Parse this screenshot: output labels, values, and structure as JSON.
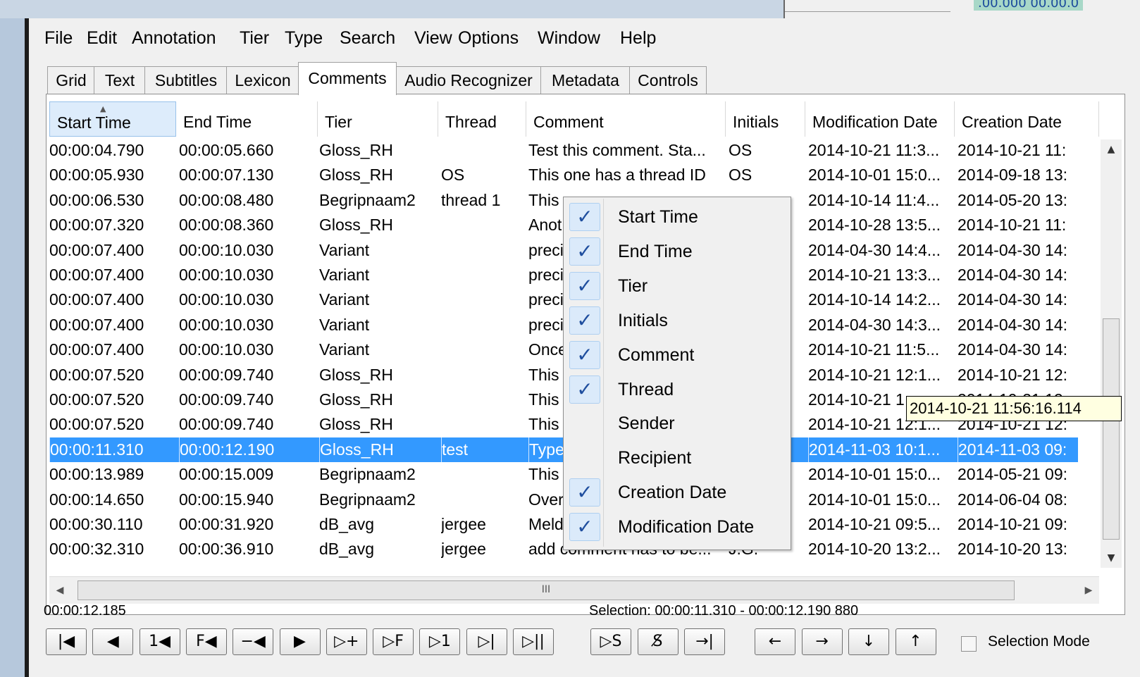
{
  "background": {
    "right_panel_text": ".00.000    00.00.0"
  },
  "menu": [
    "File",
    "Edit",
    "Annotation",
    "Tier",
    "Type",
    "Search",
    "View",
    "Options",
    "Window",
    "Help"
  ],
  "tabs": [
    "Grid",
    "Text",
    "Subtitles",
    "Lexicon",
    "Comments",
    "Audio Recognizer",
    "Metadata",
    "Controls"
  ],
  "active_tab": "Comments",
  "table": {
    "columns": [
      "Start Time",
      "End Time",
      "Tier",
      "Thread",
      "Comment",
      "Initials",
      "Modification Date",
      "Creation Date"
    ],
    "sorted_column": "Start Time",
    "rows": [
      [
        "00:00:04.790",
        "00:00:05.660",
        "Gloss_RH",
        "",
        "Test this comment. Sta...",
        "OS",
        "2014-10-21 11:3...",
        "2014-10-21 11:"
      ],
      [
        "00:00:05.930",
        "00:00:07.130",
        "Gloss_RH",
        "OS",
        "This one has a thread ID",
        "OS",
        "2014-10-01 15:0...",
        "2014-09-18 13:"
      ],
      [
        "00:00:06.530",
        "00:00:08.480",
        "Begripnaam2",
        "thread 1",
        "This",
        "",
        "2014-10-14 11:4...",
        "2014-05-20 13:"
      ],
      [
        "00:00:07.320",
        "00:00:08.360",
        "Gloss_RH",
        "",
        "Anot",
        "",
        "2014-10-28 13:5...",
        "2014-10-21 11:"
      ],
      [
        "00:00:07.400",
        "00:00:10.030",
        "Variant",
        "",
        "preci",
        "",
        "2014-04-30 14:4...",
        "2014-04-30 14:"
      ],
      [
        "00:00:07.400",
        "00:00:10.030",
        "Variant",
        "",
        "preci",
        "",
        "2014-10-21 13:3...",
        "2014-04-30 14:"
      ],
      [
        "00:00:07.400",
        "00:00:10.030",
        "Variant",
        "",
        "preci",
        "",
        "2014-10-14 14:2...",
        "2014-04-30 14:"
      ],
      [
        "00:00:07.400",
        "00:00:10.030",
        "Variant",
        "",
        "preci",
        "",
        "2014-04-30 14:3...",
        "2014-04-30 14:"
      ],
      [
        "00:00:07.400",
        "00:00:10.030",
        "Variant",
        "",
        "Once",
        "",
        "2014-10-21 11:5...",
        "2014-04-30 14:"
      ],
      [
        "00:00:07.520",
        "00:00:09.740",
        "Gloss_RH",
        "",
        "This",
        "",
        "2014-10-21 12:1...",
        "2014-10-21 12:"
      ],
      [
        "00:00:07.520",
        "00:00:09.740",
        "Gloss_RH",
        "",
        "This",
        "",
        "2014-10-21 1",
        "2014-10-21 12:"
      ],
      [
        "00:00:07.520",
        "00:00:09.740",
        "Gloss_RH",
        "",
        "This",
        "",
        "2014-10-21 12:1...",
        "2014-10-21 12:"
      ],
      [
        "00:00:11.310",
        "00:00:12.190",
        "Gloss_RH",
        "test",
        "Type",
        "",
        "2014-11-03 10:1...",
        "2014-11-03 09:"
      ],
      [
        "00:00:13.989",
        "00:00:15.009",
        "Begripnaam2",
        "",
        "This",
        "",
        "2014-10-01 15:0...",
        "2014-05-21 09:"
      ],
      [
        "00:00:14.650",
        "00:00:15.940",
        "Begripnaam2",
        "",
        "Over",
        "",
        "2014-10-01 15:0...",
        "2014-06-04 08:"
      ],
      [
        "00:00:30.110",
        "00:00:31.920",
        "dB_avg",
        "jergee",
        "Meldi",
        "",
        "2014-10-21 09:5...",
        "2014-10-21 09:"
      ],
      [
        "00:00:32.310",
        "00:00:36.910",
        "dB_avg",
        "jergee",
        "add comment has to be...",
        "J.G.",
        "2014-10-20 13:2...",
        "2014-10-20 13:"
      ]
    ],
    "selected_row": 12
  },
  "column_menu": {
    "items": [
      {
        "label": "Start Time",
        "checked": true
      },
      {
        "label": "End Time",
        "checked": true
      },
      {
        "label": "Tier",
        "checked": true
      },
      {
        "label": "Initials",
        "checked": true
      },
      {
        "label": "Comment",
        "checked": true
      },
      {
        "label": "Thread",
        "checked": true
      },
      {
        "label": "Sender",
        "checked": false
      },
      {
        "label": "Recipient",
        "checked": false
      },
      {
        "label": "Creation Date",
        "checked": true
      },
      {
        "label": "Modification Date",
        "checked": true
      }
    ],
    "check_glyph": "✓"
  },
  "tooltip": "2014-10-21 11:56:16.114",
  "scrollbars": {
    "up_glyph": "▲",
    "down_glyph": "▼",
    "left_glyph": "◀",
    "right_glyph": "▶",
    "grip_glyph": "III"
  },
  "status": {
    "current_time": "00:00:12.185",
    "selection": "Selection: 00:00:11.310 - 00:00:12.190  880"
  },
  "transport_buttons": [
    {
      "name": "go-to-begin-button",
      "glyph": "|◀"
    },
    {
      "name": "previous-frame-button",
      "glyph": "◀"
    },
    {
      "name": "back-one-second-button",
      "glyph": "1◀"
    },
    {
      "name": "frame-back-button",
      "glyph": "F◀"
    },
    {
      "name": "previous-boundary-button",
      "glyph": "−◀"
    },
    {
      "name": "play-button",
      "glyph": "▶"
    },
    {
      "name": "play-around-button",
      "glyph": "▷+"
    },
    {
      "name": "frame-forward-button",
      "glyph": "▷F"
    },
    {
      "name": "forward-one-second-button",
      "glyph": "▷1"
    },
    {
      "name": "next-frame-button",
      "glyph": "▷|"
    },
    {
      "name": "go-to-end-button",
      "glyph": "▷||"
    }
  ],
  "selection_buttons": [
    {
      "name": "play-selection-button",
      "glyph": "▷S"
    },
    {
      "name": "clear-selection-button",
      "glyph": "S̸"
    },
    {
      "name": "go-to-selection-end-button",
      "glyph": "→|"
    }
  ],
  "navigation_buttons": [
    {
      "name": "arrow-left-button",
      "glyph": "←"
    },
    {
      "name": "arrow-right-button",
      "glyph": "→"
    },
    {
      "name": "arrow-down-button",
      "glyph": "↓"
    },
    {
      "name": "arrow-up-button",
      "glyph": "↑"
    }
  ],
  "selection_mode": {
    "label": "Selection Mode",
    "checked": false
  },
  "colors": {
    "selection_blue": "#3399ff",
    "check_blue": "#1f4e9e",
    "tooltip_bg": "#ffffe1"
  }
}
